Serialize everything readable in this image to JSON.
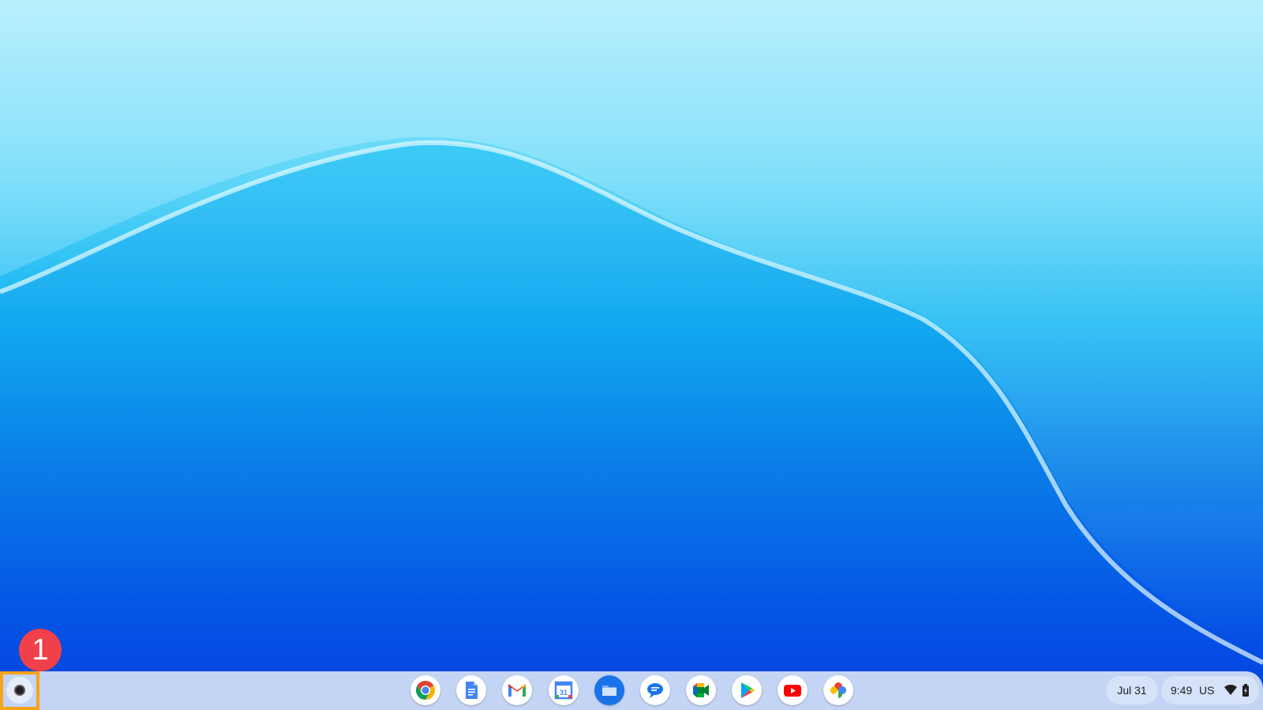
{
  "desktop": {
    "wallpaper": "blue-wave-wallpaper",
    "colors": {
      "wallpaper_top": "#9ee8fb",
      "wallpaper_bottom": "#0340e0",
      "shelf": "#c3d4f4",
      "highlight": "#f5a31a",
      "badge": "#f0414a"
    }
  },
  "annotation": {
    "number": "1"
  },
  "shelf": {
    "launcher": {
      "icon": "launcher-icon"
    },
    "apps": [
      {
        "name": "Chrome",
        "icon": "chrome-icon"
      },
      {
        "name": "Docs",
        "icon": "docs-icon"
      },
      {
        "name": "Gmail",
        "icon": "gmail-icon"
      },
      {
        "name": "Calendar",
        "icon": "calendar-icon",
        "icon_text": "31"
      },
      {
        "name": "Files",
        "icon": "files-icon"
      },
      {
        "name": "Messages",
        "icon": "messages-icon"
      },
      {
        "name": "Meet",
        "icon": "meet-icon"
      },
      {
        "name": "Play Store",
        "icon": "play-store-icon"
      },
      {
        "name": "YouTube",
        "icon": "youtube-icon"
      },
      {
        "name": "Photos",
        "icon": "photos-icon"
      }
    ]
  },
  "tray": {
    "date": "Jul 31",
    "time": "9:49",
    "locale": "US",
    "wifi_icon": "wifi-icon",
    "battery_icon": "battery-icon"
  }
}
